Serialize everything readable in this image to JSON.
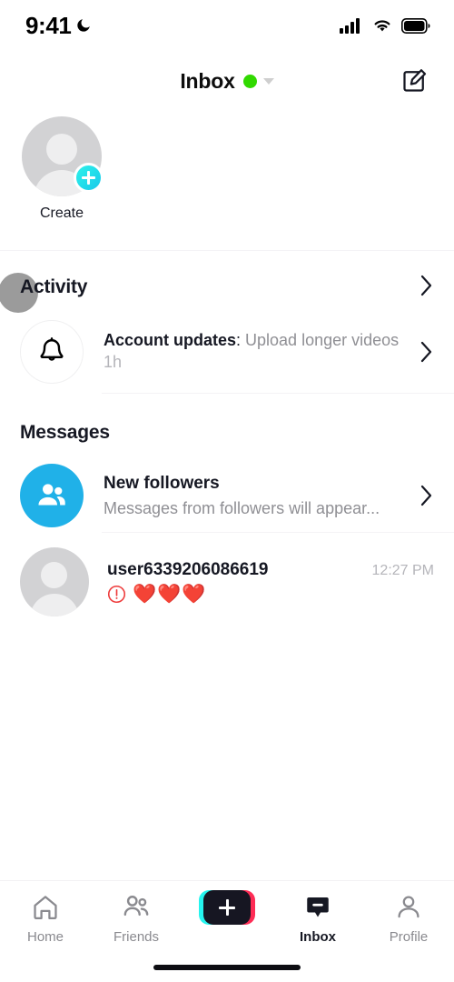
{
  "status_bar": {
    "time": "9:41",
    "dnd_icon": "moon-icon",
    "signal_icon": "cellular-signal-icon",
    "wifi_icon": "wifi-icon",
    "battery_icon": "battery-icon"
  },
  "header": {
    "title": "Inbox",
    "status_dot_color": "#31d900",
    "status_dot_icon": "online-status-dot",
    "caret_icon": "chevron-down-icon",
    "compose_icon": "compose-icon"
  },
  "stories": {
    "items": [
      {
        "label": "Create",
        "avatar_icon": "avatar-placeholder-icon",
        "badge_icon": "plus-icon"
      }
    ]
  },
  "activity": {
    "section_title": "Activity",
    "chevron_icon": "chevron-right-icon",
    "rows": [
      {
        "icon": "bell-icon",
        "title": "Account updates",
        "separator": ": ",
        "preview": "Upload longer videos",
        "time": "1h",
        "chevron_icon": "chevron-right-icon"
      }
    ]
  },
  "messages": {
    "section_title": "Messages",
    "rows": [
      {
        "icon": "two-people-icon",
        "icon_bg": "#20b1e8",
        "title": "New followers",
        "subtitle": "Messages from followers will appear...",
        "chevron_icon": "chevron-right-icon"
      },
      {
        "icon": "avatar-placeholder-icon",
        "username": "user6339206086619",
        "time": "12:27 PM",
        "error_icon": "exclamation-circle-icon",
        "preview": "❤️❤️❤️"
      }
    ]
  },
  "bottom_nav": {
    "items": [
      {
        "label": "Home",
        "icon": "home-icon",
        "active": false
      },
      {
        "label": "Friends",
        "icon": "friends-icon",
        "active": false
      },
      {
        "label": "",
        "icon": "create-plus-icon",
        "active": false
      },
      {
        "label": "Inbox",
        "icon": "inbox-icon",
        "active": true
      },
      {
        "label": "Profile",
        "icon": "profile-icon",
        "active": false
      }
    ],
    "active_color": "#161823",
    "inactive_color": "#8a8a8f"
  }
}
